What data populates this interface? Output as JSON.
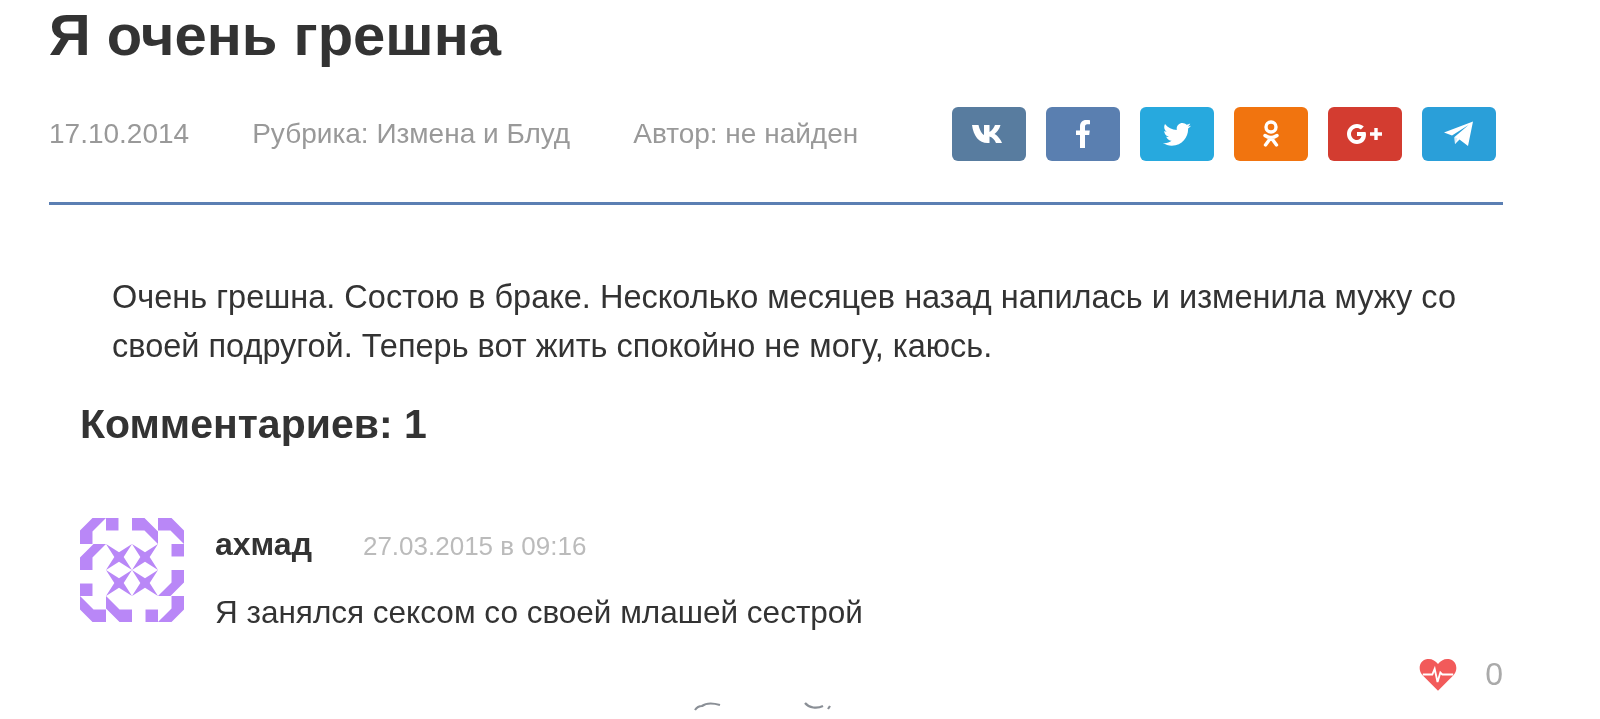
{
  "article": {
    "title": "Я очень грешна",
    "date": "17.10.2014",
    "category": "Рубрика: Измена и Блуд",
    "author": "Автор: не найден"
  },
  "share_buttons": [
    {
      "kind": "vk",
      "color": "#587c9f"
    },
    {
      "kind": "facebook",
      "color": "#5a7fb0"
    },
    {
      "kind": "twitter",
      "color": "#27a9de"
    },
    {
      "kind": "odnoklassniki",
      "color": "#f1740f"
    },
    {
      "kind": "googleplus",
      "color": "#d33c30"
    },
    {
      "kind": "telegram",
      "color": "#2a9fd9"
    }
  ],
  "body": "Очень грешна. Состою в браке. Несколько месяцев назад напилась и изменила мужу со своей подругой. Теперь вот жить спокойно не могу, каюсь.",
  "comments_heading": "Комментариев: 1",
  "comments": [
    {
      "author": "ахмад",
      "date": "27.03.2015 в 09:16",
      "text": "Я занялся сексом со своей млашей сестрой",
      "likes": "0"
    }
  ]
}
